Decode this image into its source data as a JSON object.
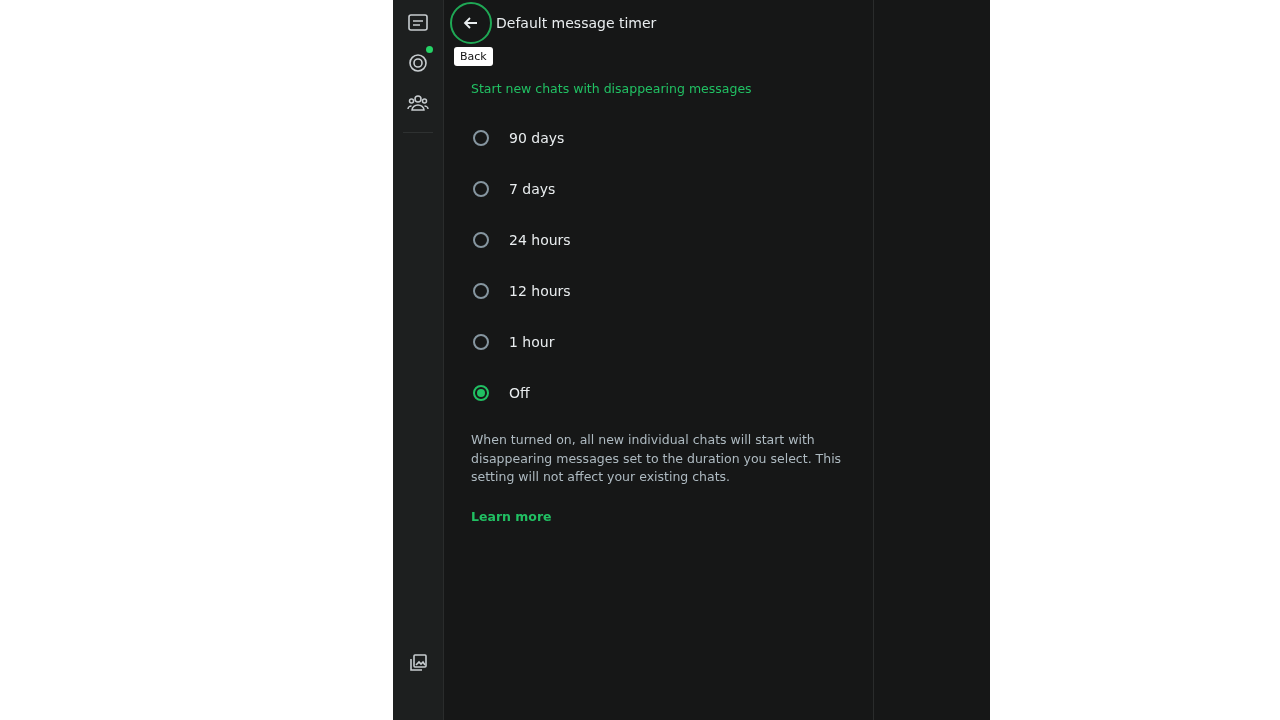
{
  "header": {
    "title": "Default message timer",
    "back_tooltip": "Back"
  },
  "section_title": "Start new chats with disappearing messages",
  "options": [
    {
      "label": "90 days",
      "selected": false
    },
    {
      "label": "7 days",
      "selected": false
    },
    {
      "label": "24 hours",
      "selected": false
    },
    {
      "label": "12 hours",
      "selected": false
    },
    {
      "label": "1 hour",
      "selected": false
    },
    {
      "label": "Off",
      "selected": true
    }
  ],
  "description": "When turned on, all new individual chats will start with disappearing messages set to the duration you select. This setting will not affect your existing chats.",
  "learn_more": "Learn more"
}
